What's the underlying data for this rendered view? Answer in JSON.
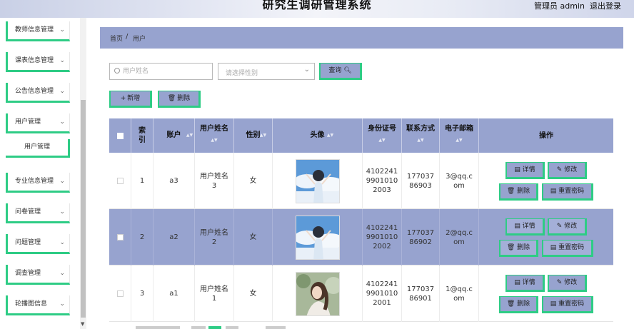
{
  "header": {
    "title": "研究生调研管理系统",
    "admin": "管理员 admin",
    "logout": "退出登录"
  },
  "sidebar": {
    "items": [
      {
        "label": "教师信息管理"
      },
      {
        "label": "课表信息管理"
      },
      {
        "label": "公告信息管理"
      },
      {
        "label": "用户管理"
      },
      {
        "label": "专业信息管理"
      },
      {
        "label": "问卷管理"
      },
      {
        "label": "问题管理"
      },
      {
        "label": "调查管理"
      },
      {
        "label": "轮播图信息"
      }
    ],
    "submenu": {
      "label": "用户管理"
    }
  },
  "breadcrumb": {
    "home": "首页",
    "sep": "/",
    "current": "用户"
  },
  "search": {
    "placeholder": "用户姓名",
    "value": "",
    "gender_placeholder": "请选择性别",
    "query_label": "查询"
  },
  "actions": {
    "add_label": "新增",
    "delete_label": "删除"
  },
  "table": {
    "columns": [
      "索引",
      "账户",
      "用户姓名",
      "性别",
      "头像",
      "身份证号",
      "联系方式",
      "电子邮箱",
      "操作"
    ],
    "row_buttons": {
      "detail": "详情",
      "edit": "修改",
      "delete": "删除",
      "reset": "重置密码"
    },
    "rows": [
      {
        "index": "1",
        "account": "a3",
        "name": "用户姓名3",
        "gender": "女",
        "avatar": "boy-sky-avatar",
        "id_card": "410224199010102003",
        "phone": "17703786903",
        "email": "3@qq.com"
      },
      {
        "index": "2",
        "account": "a2",
        "name": "用户姓名2",
        "gender": "女",
        "avatar": "boy-sky-avatar",
        "id_card": "410224199010102002",
        "phone": "17703786902",
        "email": "2@qq.com"
      },
      {
        "index": "3",
        "account": "a1",
        "name": "用户姓名1",
        "gender": "女",
        "avatar": "girl-garden-avatar",
        "id_card": "410224199010102001",
        "phone": "17703786901",
        "email": "1@qq.com"
      }
    ]
  },
  "colors": {
    "accent": "#97a3cf",
    "border_accent": "#2ecc85"
  }
}
